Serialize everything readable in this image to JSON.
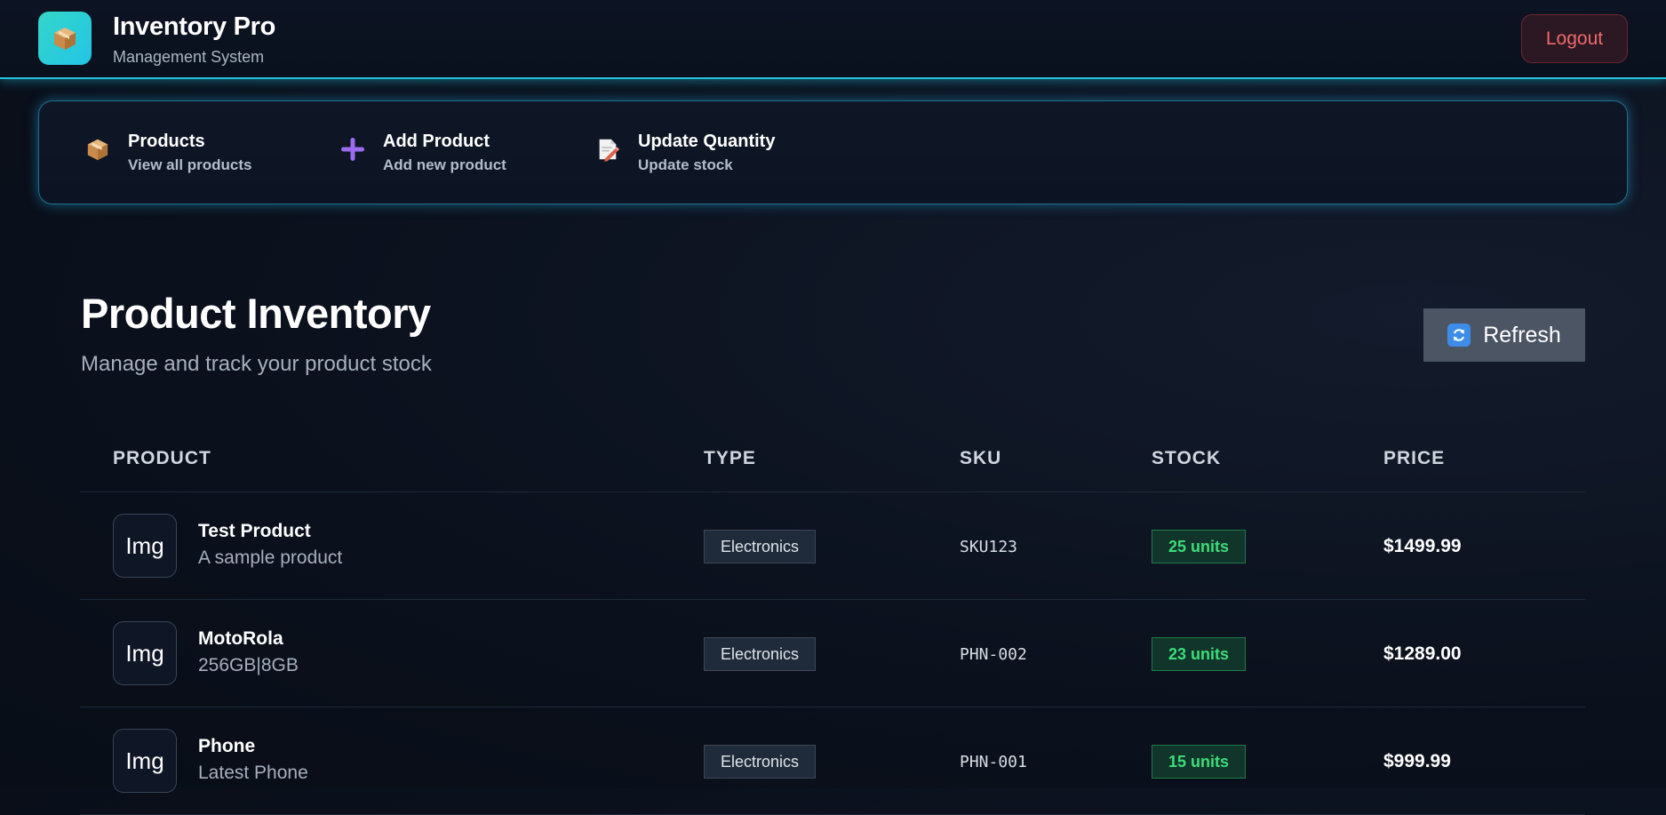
{
  "header": {
    "title": "Inventory Pro",
    "subtitle": "Management System",
    "logo_icon": "package-icon",
    "logout_label": "Logout"
  },
  "nav": {
    "items": [
      {
        "label": "Products",
        "sublabel": "View all products",
        "icon": "package-icon"
      },
      {
        "label": "Add Product",
        "sublabel": "Add new product",
        "icon": "plus-icon"
      },
      {
        "label": "Update Quantity",
        "sublabel": "Update stock",
        "icon": "memo-pencil-icon"
      }
    ]
  },
  "main": {
    "title": "Product Inventory",
    "subtitle": "Manage and track your product stock",
    "refresh_label": "Refresh",
    "refresh_icon": "refresh-icon"
  },
  "table": {
    "columns": [
      "PRODUCT",
      "TYPE",
      "SKU",
      "STOCK",
      "PRICE"
    ],
    "rows": [
      {
        "img": "Img",
        "name": "Test Product",
        "desc": "A sample product",
        "type": "Electronics",
        "sku": "SKU123",
        "stock": "25 units",
        "price": "$1499.99"
      },
      {
        "img": "Img",
        "name": "MotoRola",
        "desc": "256GB|8GB",
        "type": "Electronics",
        "sku": "PHN-002",
        "stock": "23 units",
        "price": "$1289.00"
      },
      {
        "img": "Img",
        "name": "Phone",
        "desc": "Latest Phone",
        "type": "Electronics",
        "sku": "PHN-001",
        "stock": "15 units",
        "price": "$999.99"
      }
    ]
  },
  "colors": {
    "accent": "#22c5e0",
    "logout_text": "#f06a6a",
    "stock_text": "#3ddc7a",
    "background": "#0b111d"
  }
}
